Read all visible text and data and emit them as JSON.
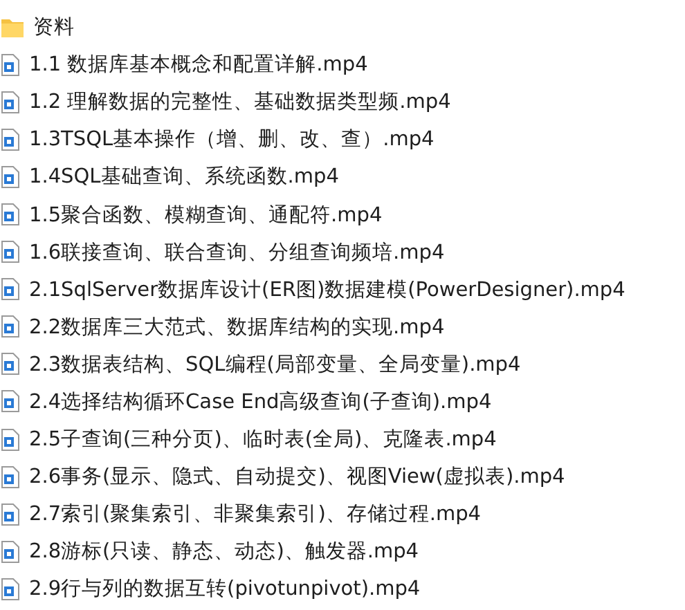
{
  "files": [
    {
      "kind": "folder",
      "name": "资料"
    },
    {
      "kind": "video",
      "name": "1.1 数据库基本概念和配置详解.mp4"
    },
    {
      "kind": "video",
      "name": "1.2 理解数据的完整性、基础数据类型频.mp4"
    },
    {
      "kind": "video",
      "name": "1.3TSQL基本操作（增、删、改、查）.mp4"
    },
    {
      "kind": "video",
      "name": "1.4SQL基础查询、系统函数.mp4"
    },
    {
      "kind": "video",
      "name": "1.5聚合函数、模糊查询、通配符.mp4"
    },
    {
      "kind": "video",
      "name": "1.6联接查询、联合查询、分组查询频培.mp4"
    },
    {
      "kind": "video",
      "name": "2.1SqlServer数据库设计(ER图)数据建模(PowerDesigner).mp4"
    },
    {
      "kind": "video",
      "name": "2.2数据库三大范式、数据库结构的实现.mp4"
    },
    {
      "kind": "video",
      "name": "2.3数据表结构、SQL编程(局部变量、全局变量).mp4"
    },
    {
      "kind": "video",
      "name": "2.4选择结构循环Case End高级查询(子查询).mp4"
    },
    {
      "kind": "video",
      "name": "2.5子查询(三种分页)、临时表(全局)、克隆表.mp4"
    },
    {
      "kind": "video",
      "name": "2.6事务(显示、隐式、自动提交)、视图View(虚拟表).mp4"
    },
    {
      "kind": "video",
      "name": "2.7索引(聚集索引、非聚集索引)、存储过程.mp4"
    },
    {
      "kind": "video",
      "name": "2.8游标(只读、静态、动态)、触发器.mp4"
    },
    {
      "kind": "video",
      "name": "2.9行与列的数据互转(pivotunpivot).mp4"
    }
  ]
}
